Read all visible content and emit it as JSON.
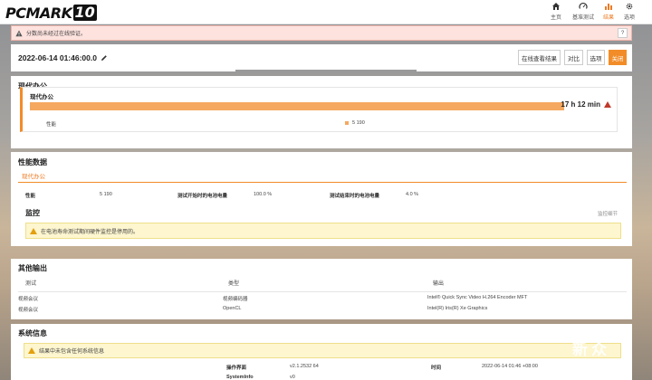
{
  "app": {
    "logo_text": "PCMARK",
    "logo_number": "10"
  },
  "nav": [
    {
      "label": "主页",
      "icon": "home-icon"
    },
    {
      "label": "基准测试",
      "icon": "gauge-icon"
    },
    {
      "label": "结果",
      "icon": "bar-chart-icon",
      "active": true
    },
    {
      "label": "选项",
      "icon": "gear-icon"
    }
  ],
  "warning": {
    "text": "分数尚未经过在线验证。",
    "help": "?"
  },
  "result": {
    "datetime": "2022-06-14 01:46:00.0",
    "buttons": {
      "view_online": "在线查看结果",
      "compare": "对比",
      "options": "选项",
      "close": "关闭"
    }
  },
  "benchmark": {
    "section_title": "现代办公",
    "card_title": "现代办公",
    "duration": "17 h 12 min",
    "bar_fill": 1.0,
    "score_label": "性能",
    "score_value": "5 190"
  },
  "perf": {
    "section_title": "性能数据",
    "tab": "现代办公",
    "row": {
      "label1": "性能",
      "value1": "5 190",
      "label2": "测试开始时的电池电量",
      "value2": "100.0 %",
      "label3": "测试结束时的电池电量",
      "value3": "4.0 %"
    },
    "monitor_title": "监控",
    "monitor_link": "监控细节",
    "monitor_warning": "在电池寿命测试期间硬件监控是停用的。"
  },
  "other": {
    "section_title": "其他输出",
    "headers": [
      "测试",
      "类型",
      "输出"
    ],
    "rows": [
      [
        "视频会议",
        "视频编码器",
        "Intel® Quick Sync Video H.264 Encoder MFT"
      ],
      [
        "视频会议",
        "OpenCL",
        "Intel(R) Iris(R) Xe Graphics"
      ]
    ]
  },
  "sysinfo": {
    "section_title": "系统信息",
    "warning": "结果中未包含任何系统信息",
    "os_label": "操作界面",
    "os_value": "v2.1.2532 64",
    "time_label": "时间",
    "time_value": "2022-06-14 01:46 +08:00",
    "sysinfo_label": "SystemInfo",
    "sysinfo_value": "v0"
  },
  "watermark": {
    "chars": [
      "新",
      "众"
    ],
    "sub": "浪"
  },
  "colors": {
    "accent": "#f28c28",
    "bar": "#f5a85f",
    "error": "#c03a2b",
    "warning_bg": "#fdf6cf"
  }
}
